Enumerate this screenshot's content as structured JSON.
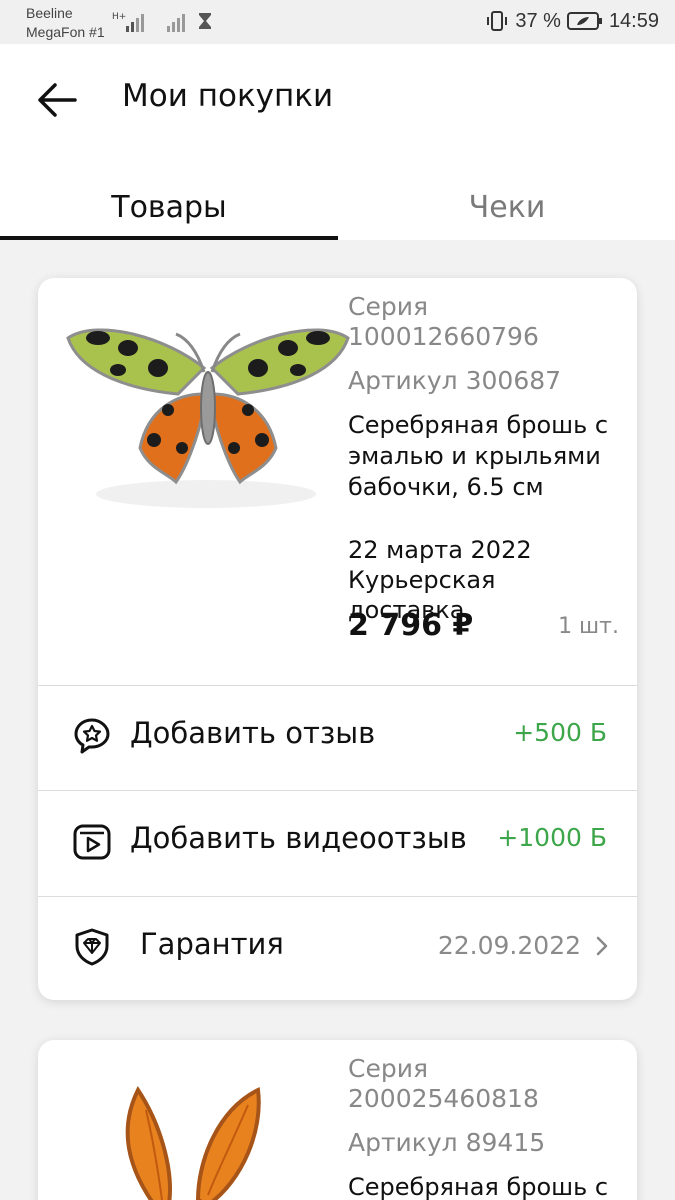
{
  "status_bar": {
    "carrier1": "Beeline",
    "carrier2": "MegaFon #1",
    "network_tag": "H+",
    "battery": "37 %",
    "time": "14:59"
  },
  "header": {
    "title": "Мои покупки",
    "tabs": [
      {
        "label": "Товары",
        "active": true
      },
      {
        "label": "Чеки",
        "active": false
      }
    ]
  },
  "products": [
    {
      "series_label": "Серия",
      "series": "100012660796",
      "article": "Артикул 300687",
      "name": "Серебряная брошь с эмалью и крыльями бабочки, 6.5 см",
      "date": "22 марта 2022",
      "delivery": "Курьерская доставка",
      "price": "2 796 ₽",
      "qty": "1 шт.",
      "image_icon": "butterfly-brooch",
      "actions": {
        "review": {
          "label": "Добавить отзыв",
          "bonus": "+500 Б",
          "icon": "review-star-icon"
        },
        "video_review": {
          "label": "Добавить видеоотзыв",
          "bonus": "+1000 Б",
          "icon": "video-play-icon"
        },
        "warranty": {
          "label": "Гарантия",
          "date": "22.09.2022",
          "icon": "diamond-shield-icon"
        }
      }
    },
    {
      "series_label": "Серия",
      "series": "200025460818",
      "article": "Артикул 89415",
      "name": "Серебряная брошь с",
      "image_icon": "amber-flower-brooch"
    }
  ],
  "colors": {
    "bonus_green": "#3ea64a",
    "muted_gray": "#888888",
    "background": "#f2f2f2"
  }
}
